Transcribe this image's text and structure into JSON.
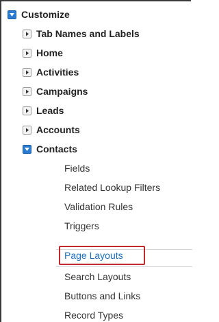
{
  "root": {
    "label": "Customize",
    "state": "expanded"
  },
  "sections": [
    {
      "label": "Tab Names and Labels",
      "state": "collapsed"
    },
    {
      "label": "Home",
      "state": "collapsed"
    },
    {
      "label": "Activities",
      "state": "collapsed"
    },
    {
      "label": "Campaigns",
      "state": "collapsed"
    },
    {
      "label": "Leads",
      "state": "collapsed"
    },
    {
      "label": "Accounts",
      "state": "collapsed"
    },
    {
      "label": "Contacts",
      "state": "expanded"
    }
  ],
  "contacts_children": [
    {
      "label": "Fields"
    },
    {
      "label": "Related Lookup Filters"
    },
    {
      "label": "Validation Rules"
    },
    {
      "label": "Triggers"
    },
    {
      "label": "Page Layouts",
      "highlighted": true
    },
    {
      "label": "Search Layouts"
    },
    {
      "label": "Buttons and Links"
    },
    {
      "label": "Record Types"
    }
  ],
  "colors": {
    "expanded_icon": "#2a7bd3",
    "link": "#1a6fbf",
    "highlight_border": "#c1272d"
  }
}
